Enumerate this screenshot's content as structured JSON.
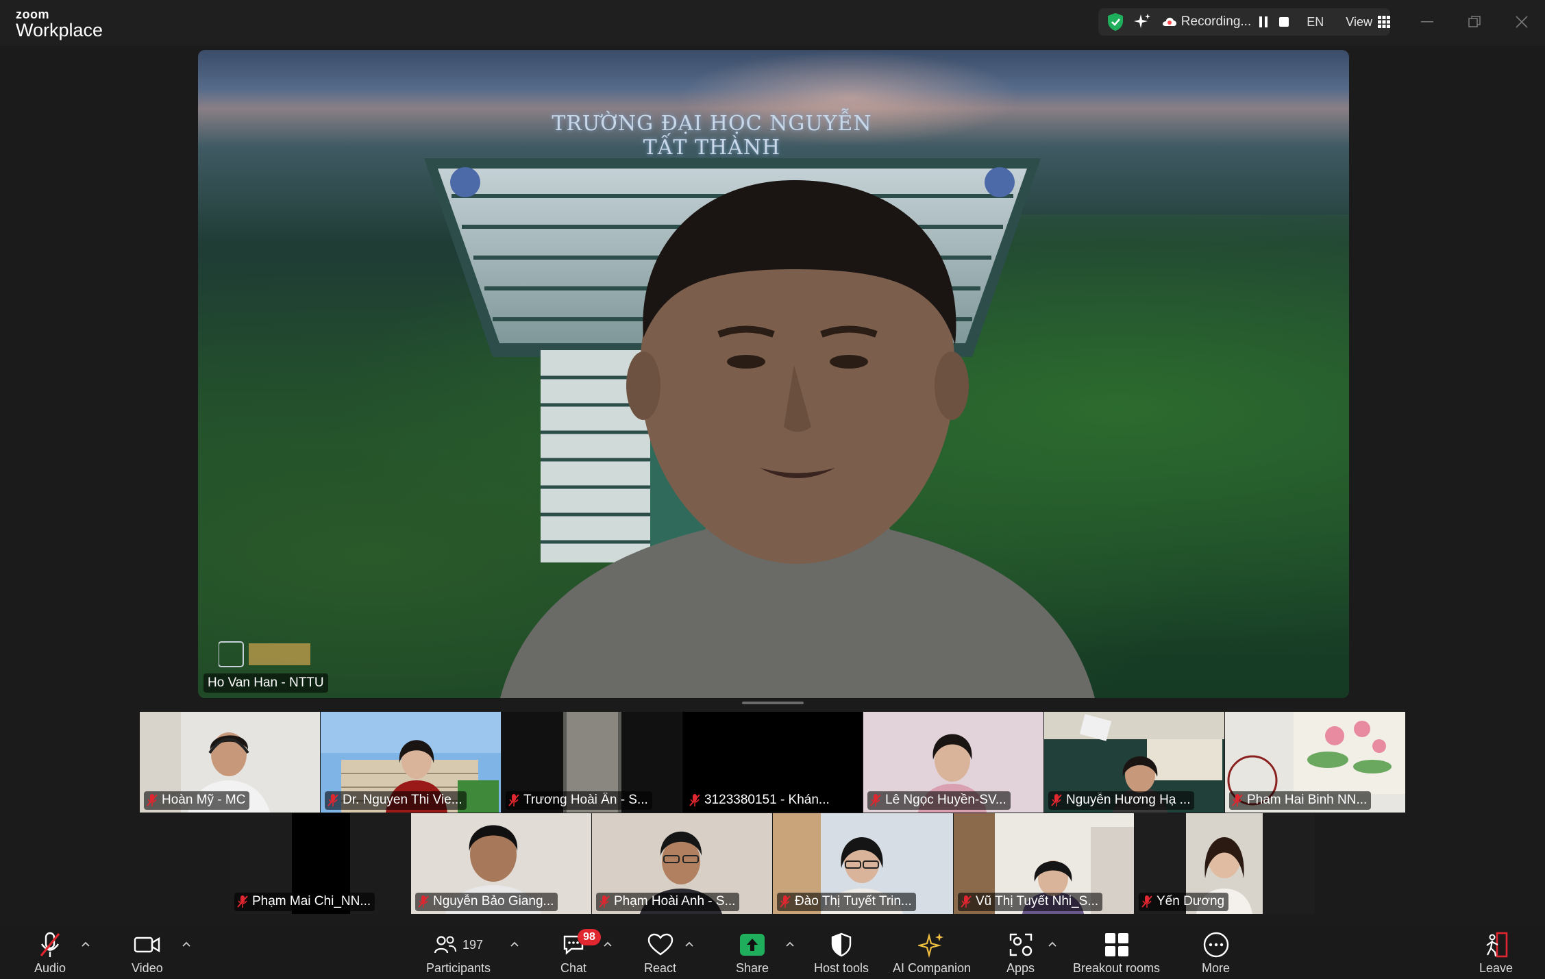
{
  "app": {
    "logo_small": "zoom",
    "logo_big": "Workplace"
  },
  "topbar": {
    "recording_label": "Recording...",
    "language": "EN",
    "view_label": "View",
    "colors": {
      "shield": "#1fae5b",
      "recording": "#ff4b4b"
    }
  },
  "speaker": {
    "name": "Ho Van Han - NTTU",
    "background_sign": "TRƯỜNG ĐẠI HỌC NGUYỄN TẤT THÀNH"
  },
  "gallery": {
    "row1": [
      {
        "name": "Hoàn Mỹ - MC"
      },
      {
        "name": "Dr. Nguyen Thi Vie..."
      },
      {
        "name": "Trương Hoài Ân - S..."
      },
      {
        "name": "3123380151 - Khán..."
      },
      {
        "name": "Lê Ngọc Huyền-SV..."
      },
      {
        "name": "Nguyễn Hương Hạ ..."
      },
      {
        "name": "Pham Hai Binh NN..."
      }
    ],
    "row2": [
      {
        "name": "Phạm Mai Chi_NN..."
      },
      {
        "name": "Nguyễn Bảo Giang..."
      },
      {
        "name": "Phạm Hoài Anh - S..."
      },
      {
        "name": "Đào Thị Tuyết Trin..."
      },
      {
        "name": "Vũ Thị Tuyết Nhi_S..."
      },
      {
        "name": "Yến Dương"
      }
    ]
  },
  "toolbar": {
    "audio": "Audio",
    "video": "Video",
    "participants": "Participants",
    "participants_count": "197",
    "chat": "Chat",
    "chat_badge": "98",
    "react": "React",
    "share": "Share",
    "host_tools": "Host tools",
    "ai_companion": "AI Companion",
    "apps": "Apps",
    "breakout_rooms": "Breakout rooms",
    "more": "More",
    "leave": "Leave",
    "colors": {
      "share": "#1fae5b",
      "leave": "#e0262f",
      "muted": "#e0262f"
    }
  }
}
